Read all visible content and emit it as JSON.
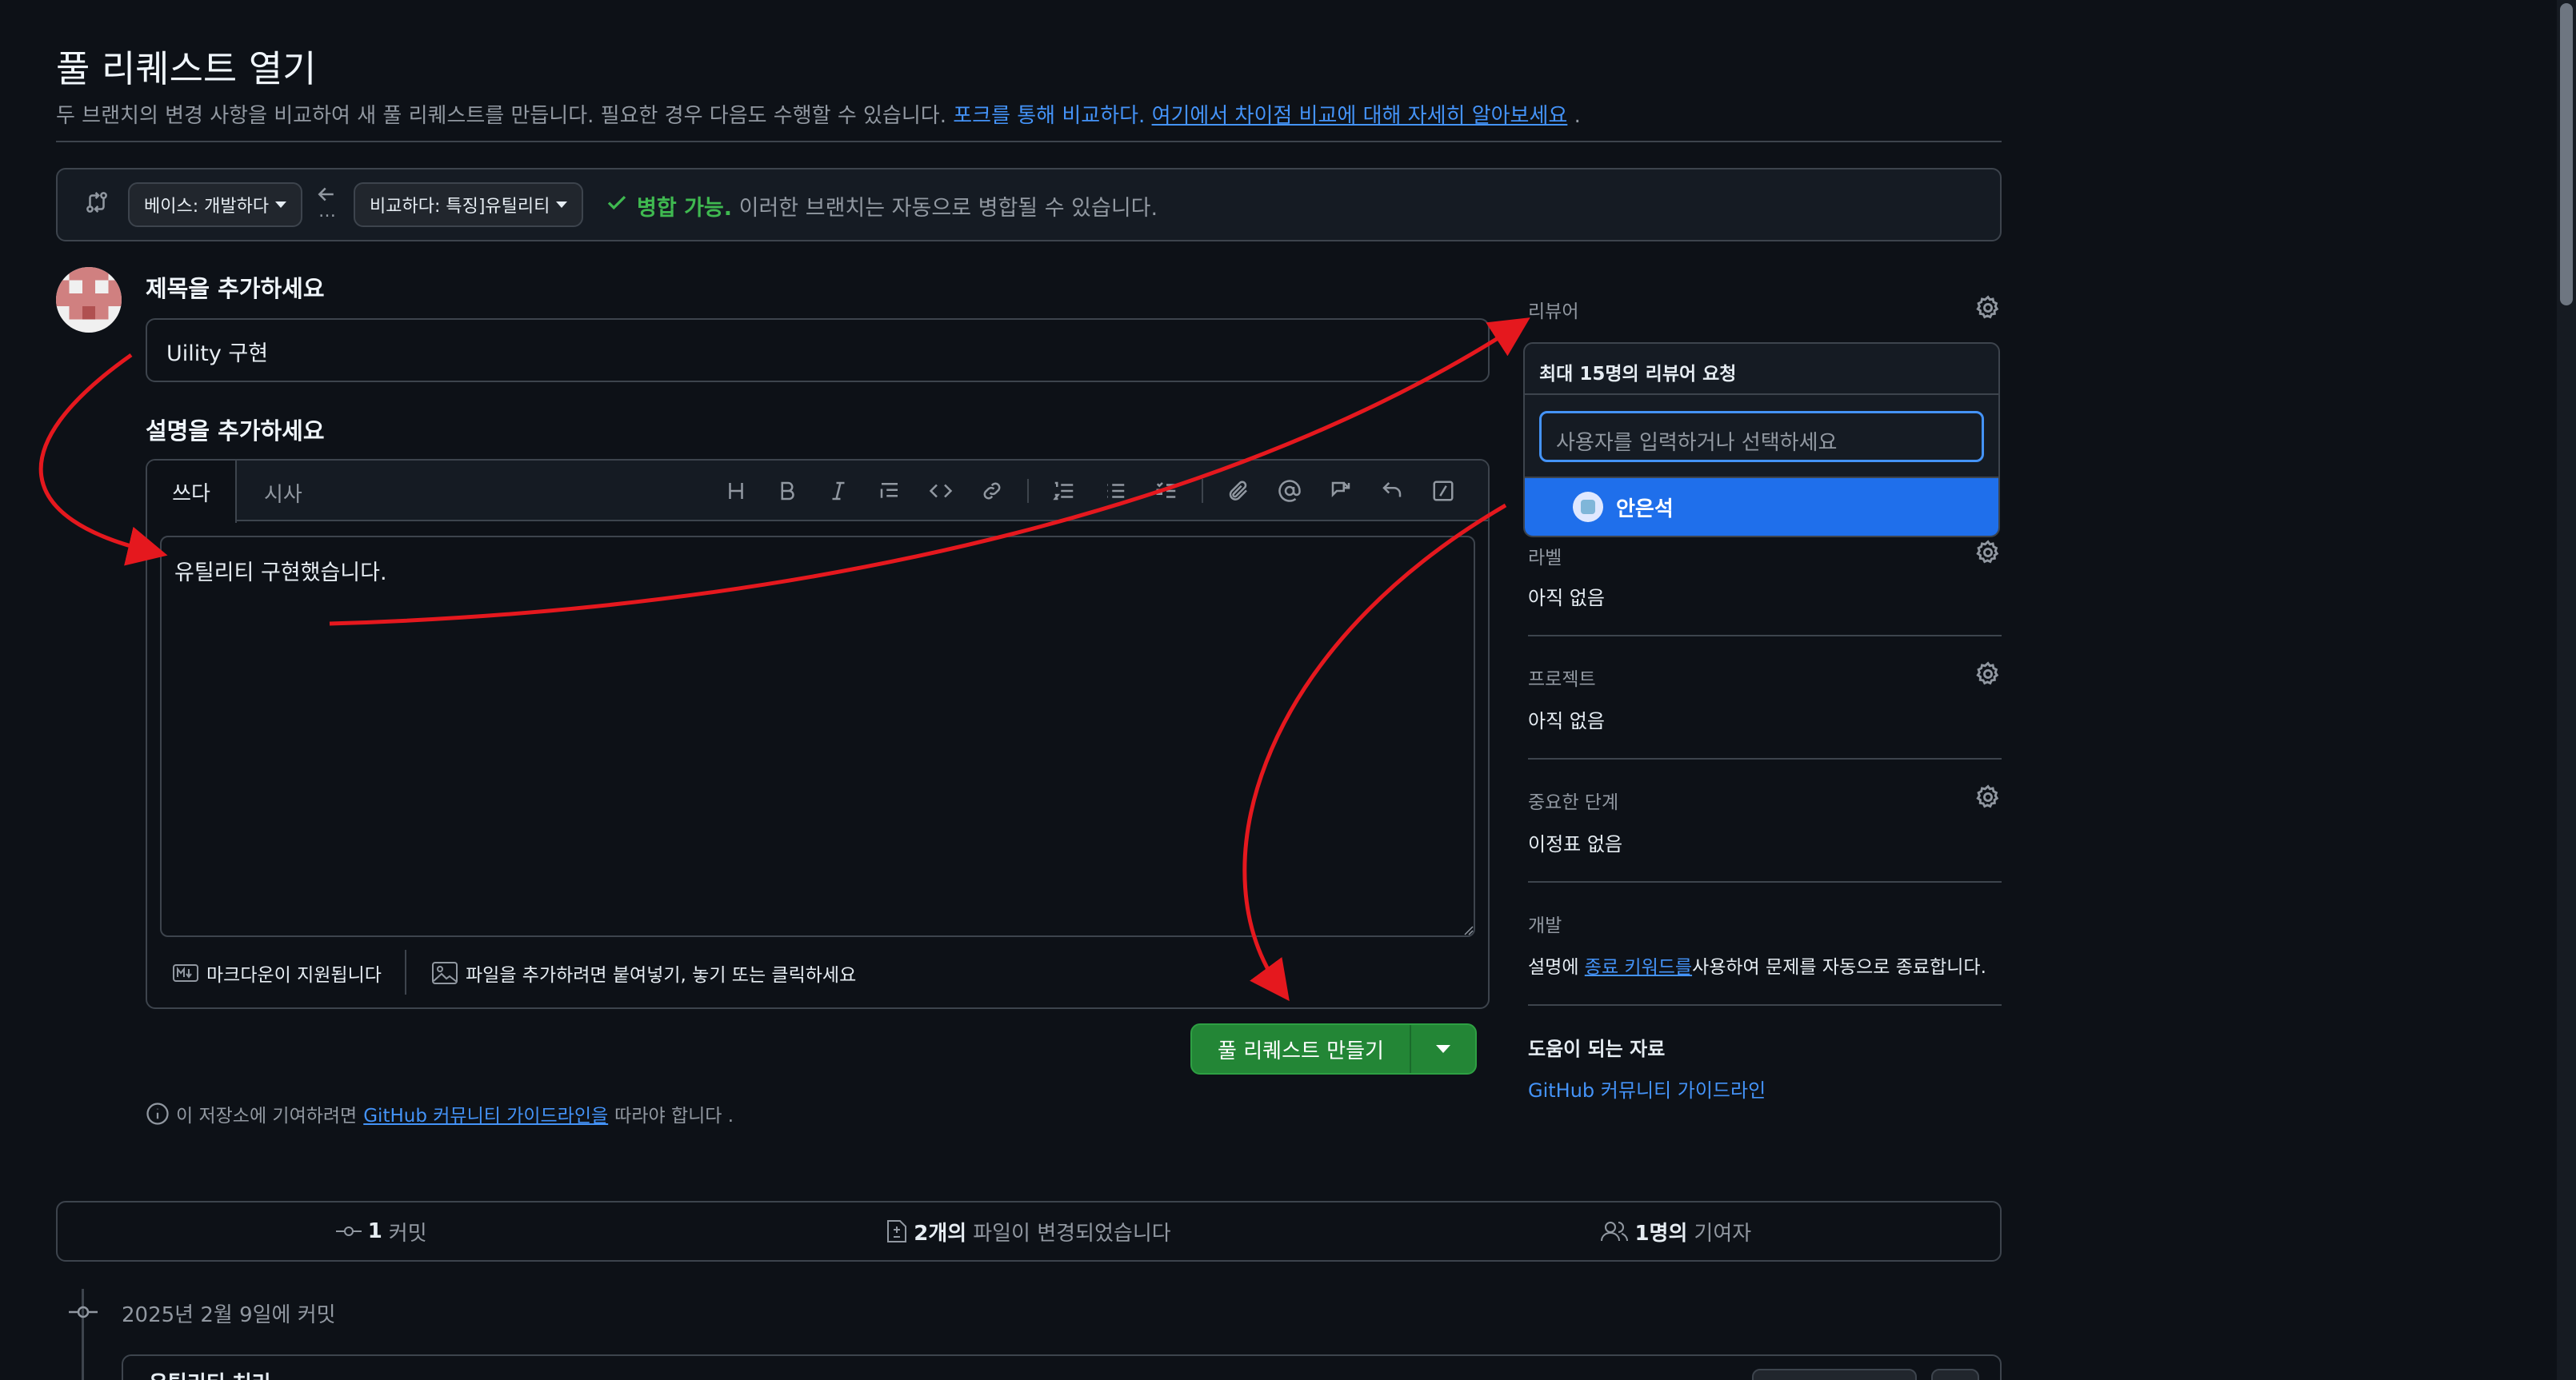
{
  "header": {
    "title": "풀 리퀘스트 열기",
    "description": "두 브랜치의 변경 사항을 비교하여 새 풀 리퀘스트를 만듭니다. 필요한 경우 다음도 수행할 수 있습니다.",
    "compare_fork_link": "포크를 통해 비교하다.",
    "learn_more_link": "여기에서 차이점 비교에 대해 자세히 알아보세요",
    "trailing_period": "."
  },
  "branch_bar": {
    "base_label": "베이스: 개발하다",
    "compare_label": "비교하다: 특징]유틸리티",
    "mergeable_status": "병합 가능.",
    "mergeable_text": "이러한 브랜치는 자동으로 병합될 수 있습니다."
  },
  "form": {
    "title_heading": "제목을 추가하세요",
    "title_value": "Uility 구현",
    "description_heading": "설명을 추가하세요",
    "tab_write": "쓰다",
    "tab_preview": "시사",
    "body_value": "유틸리티 구현했습니다.",
    "markdown_note": "마크다운이 지원됩니다",
    "attach_note": "파일을 추가하려면 붙여넣기, 놓기 또는 클릭하세요",
    "submit_label": "풀 리퀘스트 만들기",
    "contrib_prefix": "이 저장소에 기여하려면",
    "contrib_link": "GitHub 커뮤니티 가이드라인을",
    "contrib_suffix": "따라야 합니다 ."
  },
  "sidebar": {
    "reviewers_label": "리뷰어",
    "dropdown_title": "최대 15명의 리뷰어 요청",
    "dropdown_placeholder": "사용자를 입력하거나 선택하세요",
    "dropdown_option": "안은석",
    "labels_label": "라벨",
    "labels_value": "아직 없음",
    "projects_label": "프로젝트",
    "projects_value": "아직 없음",
    "milestone_label": "중요한 단계",
    "milestone_value": "이정표 없음",
    "development_label": "개발",
    "development_prefix": "설명에",
    "development_link": "종료 키워드를",
    "development_suffix": "사용하여 문제를 자동으로 종료합니다.",
    "resources_label": "도움이 되는 자료",
    "resources_link": "GitHub 커뮤니티 가이드라인"
  },
  "stats": {
    "commits_count": "1",
    "commits_label": "커밋",
    "files_count": "2개의",
    "files_label": "파일이 변경되었습니다",
    "contributors_count": "1명의",
    "contributors_label": "기여자"
  },
  "timeline": {
    "date_label": "2025년 2월 9일에 커밋",
    "commit_title": "유틸리티 처리"
  },
  "colors": {
    "background": "#0d1117",
    "accent_link": "#4493f8",
    "success": "#3fb950",
    "primary_button": "#238636",
    "dropdown_selected": "#1f6feb",
    "annotation_arrow": "#e5181e"
  }
}
